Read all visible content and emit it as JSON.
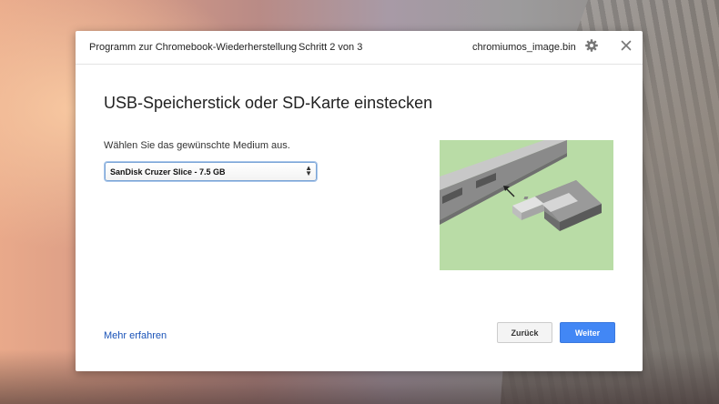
{
  "header": {
    "app_name": "Programm zur Chromebook-Wiederherstellung",
    "separator": "›",
    "step": "Schritt 2 von 3",
    "file_name": "chromiumos_image.bin",
    "settings_icon": "gear-icon",
    "close_icon": "close-icon"
  },
  "main": {
    "title": "USB-Speicherstick oder SD-Karte einstecken",
    "prompt": "Wählen Sie das gewünschte Medium aus.",
    "media_select": {
      "selected": "SanDisk Cruzer Slice - 7.5 GB"
    },
    "illustration": "usb-insert-illustration"
  },
  "footer": {
    "learn_more": "Mehr erfahren",
    "back_label": "Zurück",
    "next_label": "Weiter"
  },
  "colors": {
    "accent": "#4287f5",
    "link": "#1a53b8",
    "illustration_bg": "#b9dca6"
  }
}
